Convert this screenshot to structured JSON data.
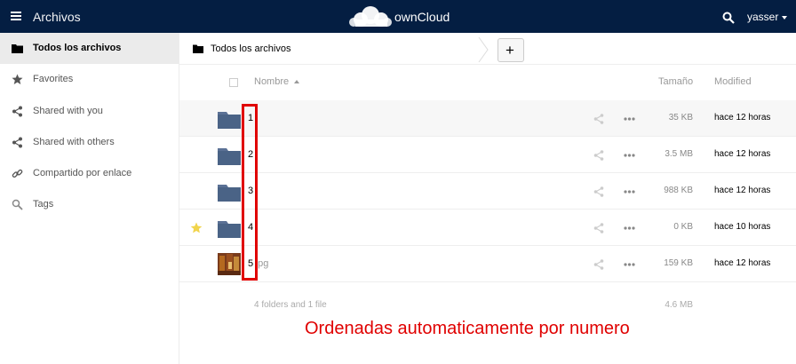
{
  "header": {
    "app_title": "Archivos",
    "logo_text": "ownCloud",
    "user_name": "yasser",
    "colors": {
      "bar": "#041e42"
    }
  },
  "sidebar": {
    "items": [
      {
        "label": "Todos los archivos",
        "icon": "folder-icon",
        "active": true
      },
      {
        "label": "Favorites",
        "icon": "star-icon",
        "active": false
      },
      {
        "label": "Shared with you",
        "icon": "share-icon",
        "active": false
      },
      {
        "label": "Shared with others",
        "icon": "share-icon",
        "active": false
      },
      {
        "label": "Compartido por enlace",
        "icon": "link-icon",
        "active": false
      },
      {
        "label": "Tags",
        "icon": "tag-icon",
        "active": false
      }
    ]
  },
  "breadcrumb": {
    "label": "Todos los archivos"
  },
  "new_button": {
    "label": "+"
  },
  "table": {
    "headers": {
      "name": "Nombre",
      "size": "Tamaño",
      "modified": "Modified"
    },
    "rows": [
      {
        "name": "1",
        "ext": "",
        "type": "folder",
        "favorite": false,
        "size": "35 KB",
        "modified": "hace 12 horas"
      },
      {
        "name": "2",
        "ext": "",
        "type": "folder",
        "favorite": false,
        "size": "3.5 MB",
        "modified": "hace 12 horas"
      },
      {
        "name": "3",
        "ext": "",
        "type": "folder",
        "favorite": false,
        "size": "988 KB",
        "modified": "hace 12 horas"
      },
      {
        "name": "4",
        "ext": "",
        "type": "folder",
        "favorite": true,
        "size": "0 KB",
        "modified": "hace 10 horas"
      },
      {
        "name": "5",
        "ext": "pg",
        "type": "image",
        "favorite": false,
        "size": "159 KB",
        "modified": "hace 12 horas"
      }
    ],
    "summary": {
      "count": "4 folders and 1 file",
      "size": "4.6 MB"
    }
  },
  "annotation": {
    "text": "Ordenadas automaticamente por numero",
    "color": "#e00000"
  }
}
